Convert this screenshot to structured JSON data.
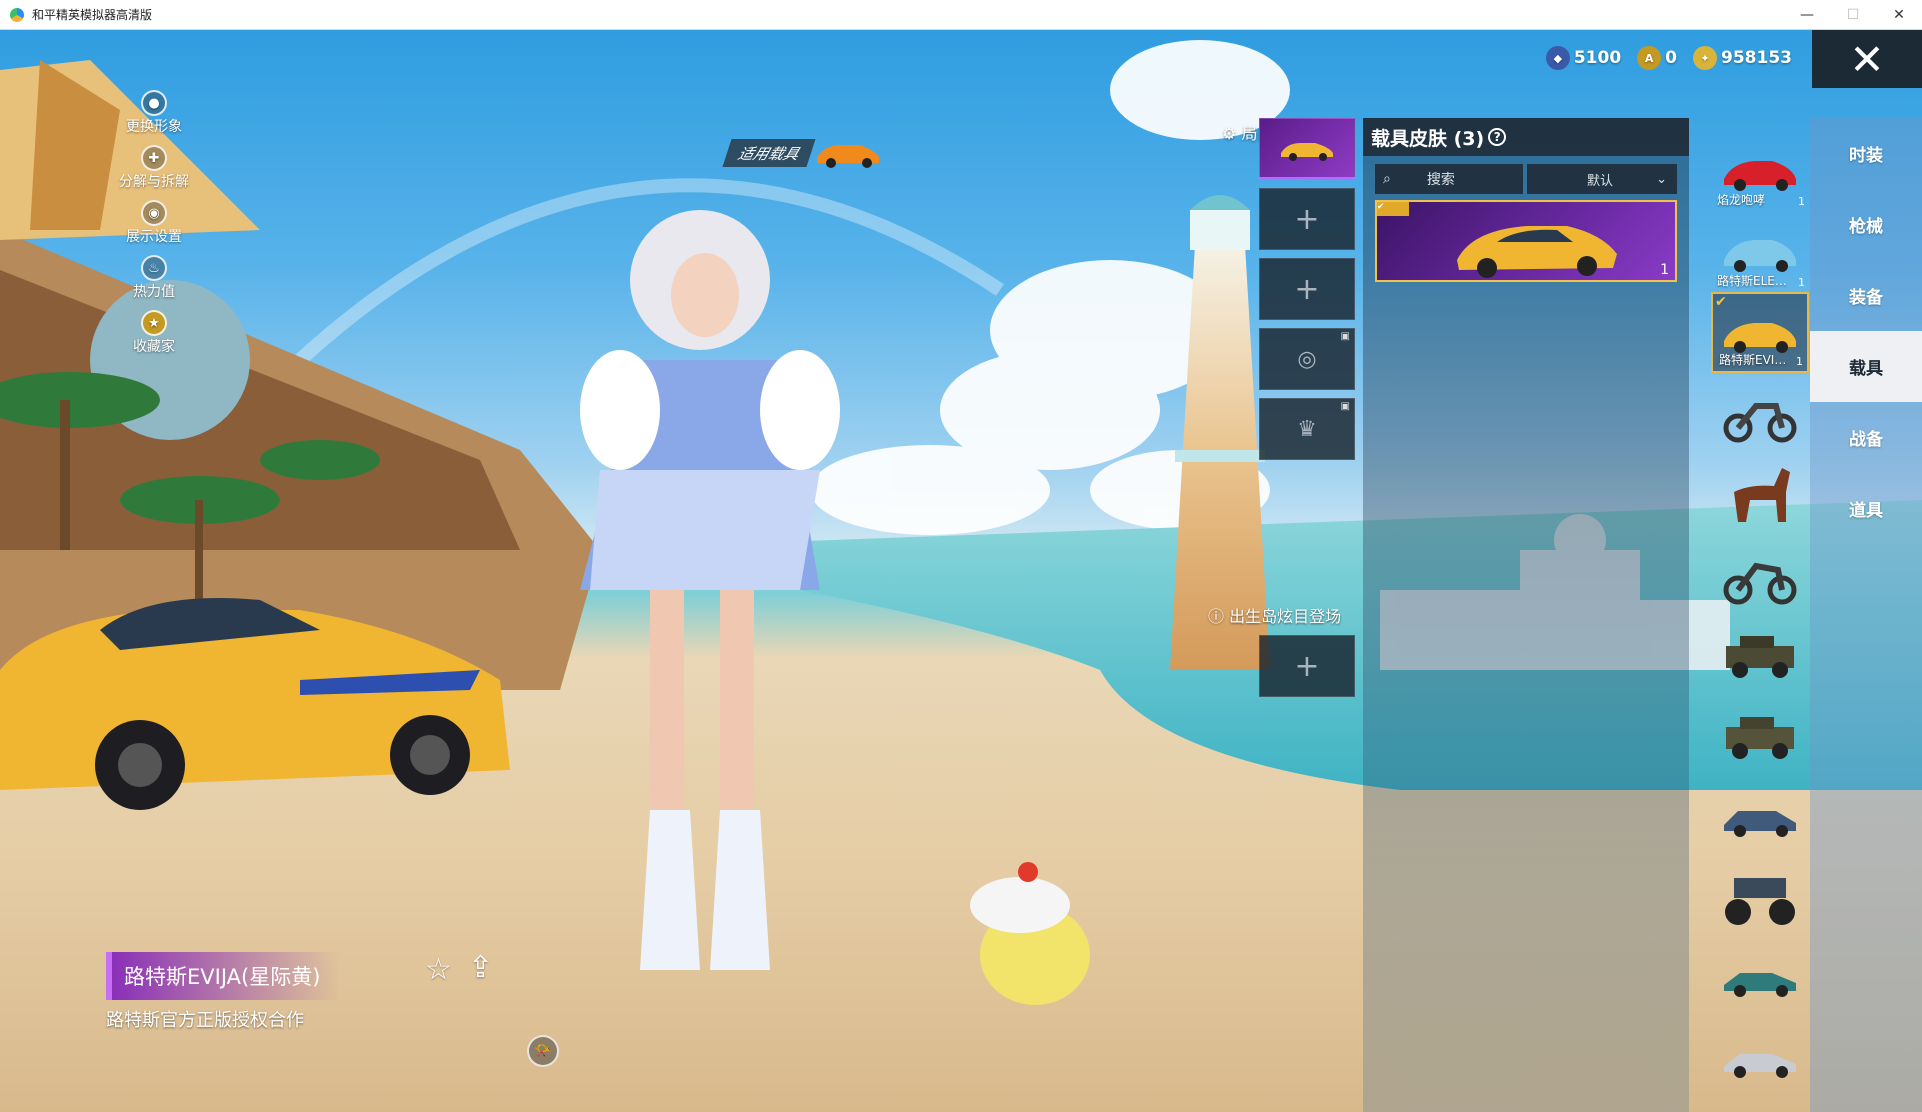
{
  "window": {
    "title": "和平精英模拟器高清版",
    "min": "—",
    "max": "☐",
    "close": "✕"
  },
  "side_menu": [
    {
      "label": "更换形象",
      "icon": "person-icon"
    },
    {
      "label": "分解与拆解",
      "icon": "puzzle-icon"
    },
    {
      "label": "展示设置",
      "icon": "eye-icon"
    },
    {
      "label": "热力值",
      "icon": "flame-icon"
    },
    {
      "label": "收藏家",
      "icon": "badge-icon"
    }
  ],
  "currency": [
    {
      "value": "5100",
      "color": "#3a5aa8"
    },
    {
      "value": "0",
      "color": "#c49a22"
    },
    {
      "value": "958153",
      "color": "#d8b43a"
    }
  ],
  "apply_vehicle": {
    "label": "适用载具"
  },
  "slots": {
    "title": "局内皮肤设置",
    "island_label": "出生岛炫目登场",
    "plus": "+"
  },
  "skins": {
    "title": "载具皮肤 (3)",
    "help": "?",
    "search_label": "搜索",
    "sort_label": "默认",
    "card_count": "1"
  },
  "vehicles": [
    {
      "name": "焰龙咆哮",
      "count": "1",
      "kind": "red-car"
    },
    {
      "name": "路特斯ELE…",
      "count": "1",
      "kind": "blue-car"
    },
    {
      "name": "路特斯EVI…",
      "count": "1",
      "kind": "yellow-car",
      "selected": true
    },
    {
      "name": "",
      "count": "",
      "kind": "motorcycle"
    },
    {
      "name": "",
      "count": "",
      "kind": "horse"
    },
    {
      "name": "",
      "count": "",
      "kind": "motorcycle"
    },
    {
      "name": "",
      "count": "",
      "kind": "jeep"
    },
    {
      "name": "",
      "count": "",
      "kind": "jeep"
    },
    {
      "name": "",
      "count": "",
      "kind": "sedan"
    },
    {
      "name": "",
      "count": "",
      "kind": "monster-truck"
    },
    {
      "name": "",
      "count": "",
      "kind": "classic-car"
    },
    {
      "name": "",
      "count": "",
      "kind": "classic-car"
    }
  ],
  "categories": [
    "时装",
    "枪械",
    "装备",
    "载具",
    "战备",
    "道具"
  ],
  "active_category": "载具",
  "item": {
    "name": "路特斯EVIJA(星际黄)",
    "desc": "路特斯官方正版授权合作"
  },
  "colors": {
    "accent_purple": "#8a2fb8",
    "gold": "#f2c14a",
    "car_yellow": "#f0b531"
  }
}
